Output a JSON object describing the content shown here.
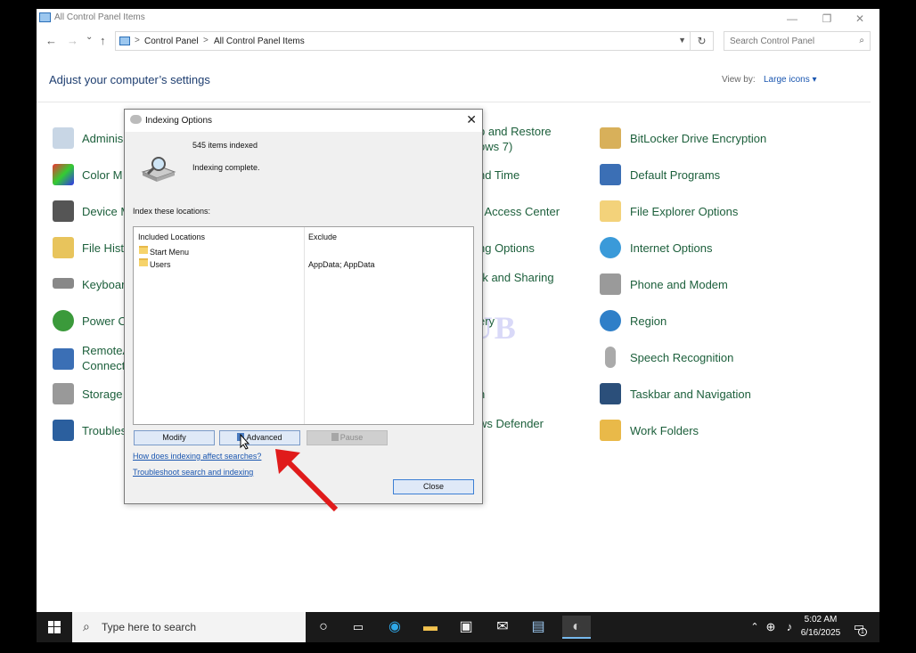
{
  "window": {
    "title": "All Control Panel Items",
    "minimize": "—",
    "restore": "❐",
    "close": "✕"
  },
  "nav": {
    "back": "←",
    "forward": "→",
    "recent": "⌄",
    "up": "↑",
    "breadcrumb": [
      "Control Panel",
      "All Control Panel Items"
    ],
    "separator": ">",
    "refresh": "↻",
    "search_placeholder": "Search Control Panel"
  },
  "header": {
    "title": "Adjust your computer’s settings",
    "view_by_label": "View by:",
    "view_by_value": "Large icons ▾"
  },
  "items": {
    "col1": [
      "Adminis",
      "Color M",
      "Device M",
      "File Hist",
      "Keyboar",
      "Power O",
      "RemoteA",
      "Connect",
      "Storage",
      "Troubles"
    ],
    "col2": [
      "p and Restore",
      "ows 7)",
      "nd Time",
      "f Access Center",
      "ng Options",
      "rk and Sharing",
      "ery",
      "n",
      "ws Defender",
      "ll"
    ],
    "col3": [
      "BitLocker Drive Encryption",
      "Default Programs",
      "File Explorer Options",
      "Internet Options",
      "Phone and Modem",
      "Region",
      "Speech Recognition",
      "Taskbar and Navigation",
      "Work Folders"
    ]
  },
  "watermark": "IT ProsHUB",
  "dialog": {
    "title": "Indexing Options",
    "close": "✕",
    "items_indexed": "545 items indexed",
    "status": "Indexing complete.",
    "index_label": "Index these locations:",
    "col_included": "Included Locations",
    "col_exclude": "Exclude",
    "locations": [
      {
        "name": "Start Menu",
        "exclude": ""
      },
      {
        "name": "Users",
        "exclude": "AppData; AppData"
      }
    ],
    "btn_modify": "Modify",
    "btn_advanced": "Advanced",
    "btn_pause": "Pause",
    "link_how": "How does indexing affect searches?",
    "link_troubleshoot": "Troubleshoot search and indexing",
    "btn_close": "Close"
  },
  "taskbar": {
    "search_placeholder": "Type here to search",
    "time": "5:02 AM",
    "date": "6/16/2025",
    "notif_count": "1"
  }
}
